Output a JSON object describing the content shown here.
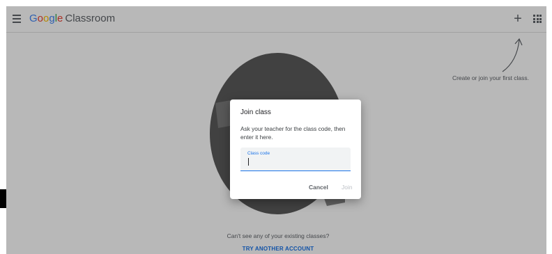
{
  "header": {
    "logo_google_letters": [
      "G",
      "o",
      "o",
      "g",
      "l",
      "e"
    ],
    "logo_colors": [
      "#4285F4",
      "#EA4335",
      "#FBBC05",
      "#4285F4",
      "#34A853",
      "#EA4335"
    ],
    "logo_product": "Classroom",
    "menu_icon": "hamburger-icon",
    "add_icon": "plus-icon",
    "apps_icon": "apps-grid-icon"
  },
  "main": {
    "hint": "Create or join your first class.",
    "bottom_text": "Can't see any of your existing classes?",
    "bottom_link": "TRY ANOTHER ACCOUNT"
  },
  "dialog": {
    "title": "Join class",
    "description": "Ask your teacher for the class code, then enter it here.",
    "field_label": "Class code",
    "field_value": "",
    "cancel_label": "Cancel",
    "join_label": "Join"
  },
  "colors": {
    "accent": "#1a73e8",
    "icon": "#5f6368",
    "disabled": "#bdc1c6"
  }
}
